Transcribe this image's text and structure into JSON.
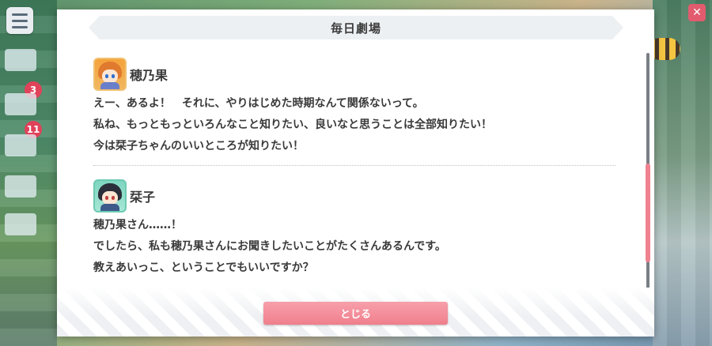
{
  "dialog": {
    "title": "毎日劇場",
    "close_label": "とじる"
  },
  "entries": [
    {
      "speaker": "穂乃果",
      "avatar": "honoka-avatar",
      "lines": [
        "えー、あるよ！　それに、やりはじめた時期なんて関係ないって。",
        "私ね、もっともっといろんなこと知りたい、良いなと思うことは全部知りたい！",
        "今は栞子ちゃんのいいところが知りたい！"
      ]
    },
    {
      "speaker": "栞子",
      "avatar": "shioriko-avatar",
      "lines": [
        "穂乃果さん……！",
        "でしたら、私も穂乃果さんにお聞きしたいことがたくさんあるんです。",
        "教えあいっこ、ということでもいいですか？"
      ]
    }
  ],
  "background": {
    "badges": [
      "3",
      "11"
    ]
  },
  "colors": {
    "accent": "#f07f8c",
    "header_bg": "#edf0f3",
    "text": "#3a3a3a"
  }
}
